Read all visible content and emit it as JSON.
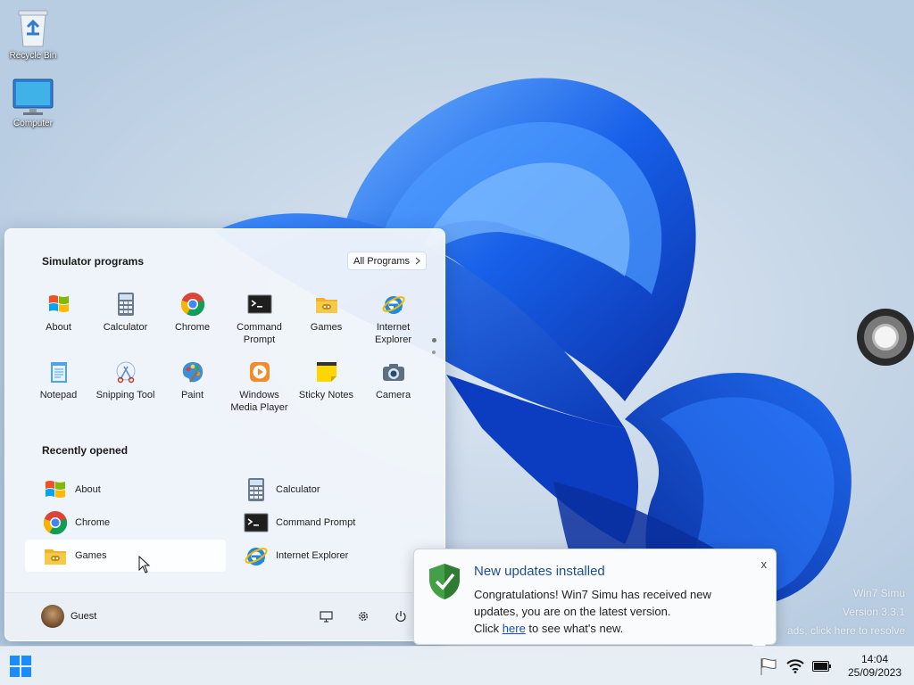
{
  "desktop": {
    "icons": [
      {
        "label": "Recycle Bin",
        "icon": "recycle-bin-icon"
      },
      {
        "label": "Computer",
        "icon": "computer-monitor-icon"
      }
    ],
    "watermark": {
      "line1": "Win7 Simu",
      "line2": "Version 3.3.1",
      "line3": "ads, click here to resolve"
    }
  },
  "start_menu": {
    "pinned_title": "Simulator programs",
    "all_programs_label": "All Programs",
    "pinned_apps": [
      {
        "label": "About",
        "icon": "windows-flag-icon"
      },
      {
        "label": "Calculator",
        "icon": "calculator-icon"
      },
      {
        "label": "Chrome",
        "icon": "chrome-icon"
      },
      {
        "label": "Command Prompt",
        "icon": "command-prompt-icon"
      },
      {
        "label": "Games",
        "icon": "games-folder-icon"
      },
      {
        "label": "Internet Explorer",
        "icon": "internet-explorer-icon"
      },
      {
        "label": "Notepad",
        "icon": "notepad-icon"
      },
      {
        "label": "Snipping Tool",
        "icon": "snipping-tool-icon"
      },
      {
        "label": "Paint",
        "icon": "paint-palette-icon"
      },
      {
        "label": "Windows Media Player",
        "icon": "media-player-icon"
      },
      {
        "label": "Sticky Notes",
        "icon": "sticky-notes-icon"
      },
      {
        "label": "Camera",
        "icon": "camera-icon"
      }
    ],
    "recent_title": "Recently opened",
    "recent_apps": [
      {
        "label": "About",
        "icon": "windows-flag-icon"
      },
      {
        "label": "Calculator",
        "icon": "calculator-icon"
      },
      {
        "label": "Chrome",
        "icon": "chrome-icon"
      },
      {
        "label": "Command Prompt",
        "icon": "command-prompt-icon"
      },
      {
        "label": "Games",
        "icon": "games-folder-icon"
      },
      {
        "label": "Internet Explorer",
        "icon": "internet-explorer-icon"
      }
    ],
    "user_name": "Guest"
  },
  "notification": {
    "title": "New updates installed",
    "message_line1": "Congratulations! Win7 Simu has received new",
    "message_line2": "updates, you are on the latest version.",
    "message_pre": "Click ",
    "link_text": "here",
    "message_post": " to see what's new.",
    "close_label": "x"
  },
  "taskbar": {
    "time": "14:04",
    "date": "25/09/2023"
  },
  "colors": {
    "accent": "#1a73e8",
    "toast_title": "#1d4f91",
    "link": "#1a4fb5"
  }
}
